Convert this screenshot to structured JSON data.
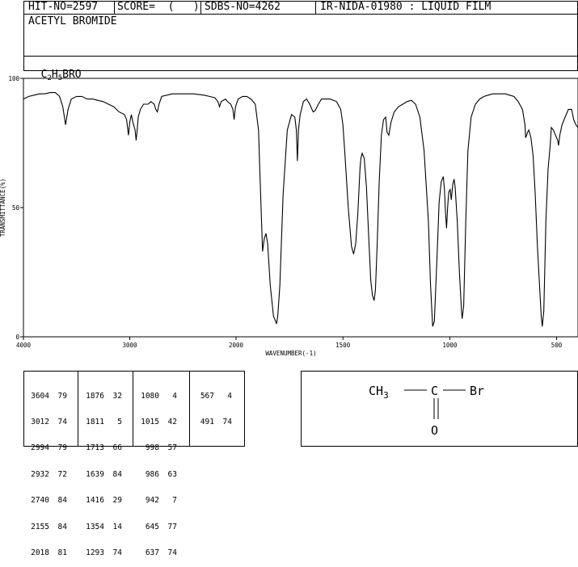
{
  "header": {
    "hit_no": "HIT-NO=2597",
    "score": "SCORE=  (   )",
    "sdbs_no": "SDBS-NO=4262",
    "ir_info": "IR-NIDA-01980 : LIQUID FILM",
    "compound_name": "ACETYL BROMIDE",
    "formula": {
      "c": "C",
      "c_sub": "2",
      "h": "H",
      "h_sub": "5",
      "rest": "BRO"
    }
  },
  "chart_data": {
    "type": "line",
    "xlabel": "WAVENUMBER(-1)",
    "ylabel": "TRANSMITTANCE(%)",
    "xlim": [
      4000,
      400
    ],
    "ylim": [
      0,
      100
    ],
    "x_ticks": [
      4000,
      3000,
      2000,
      1500,
      1000,
      500
    ],
    "y_ticks": [
      0,
      50,
      100
    ],
    "x_tick_labels": [
      "4000",
      "3000",
      "2000",
      "1500",
      "1000",
      "500"
    ],
    "y_tick_labels": [
      "0",
      "50",
      "100"
    ],
    "grid": false,
    "series_color": "#000000",
    "spectrum": [
      [
        4000,
        92
      ],
      [
        3950,
        93
      ],
      [
        3900,
        93.5
      ],
      [
        3850,
        94
      ],
      [
        3800,
        94
      ],
      [
        3750,
        94.5
      ],
      [
        3700,
        94.5
      ],
      [
        3660,
        93
      ],
      [
        3630,
        89
      ],
      [
        3604,
        82
      ],
      [
        3580,
        88
      ],
      [
        3550,
        92
      ],
      [
        3500,
        93
      ],
      [
        3450,
        93
      ],
      [
        3400,
        92
      ],
      [
        3350,
        92
      ],
      [
        3300,
        91.5
      ],
      [
        3250,
        91
      ],
      [
        3200,
        90
      ],
      [
        3150,
        89
      ],
      [
        3100,
        87
      ],
      [
        3050,
        86
      ],
      [
        3030,
        84
      ],
      [
        3012,
        78
      ],
      [
        3000,
        83
      ],
      [
        2985,
        86
      ],
      [
        2970,
        83
      ],
      [
        2950,
        80
      ],
      [
        2940,
        76
      ],
      [
        2932,
        79
      ],
      [
        2920,
        85
      ],
      [
        2900,
        88
      ],
      [
        2870,
        90
      ],
      [
        2830,
        90
      ],
      [
        2800,
        91
      ],
      [
        2770,
        90
      ],
      [
        2755,
        88
      ],
      [
        2740,
        87
      ],
      [
        2725,
        90
      ],
      [
        2700,
        93
      ],
      [
        2600,
        94
      ],
      [
        2500,
        94
      ],
      [
        2400,
        94
      ],
      [
        2300,
        93.5
      ],
      [
        2250,
        93
      ],
      [
        2200,
        92.5
      ],
      [
        2170,
        91
      ],
      [
        2155,
        89
      ],
      [
        2140,
        91
      ],
      [
        2100,
        92
      ],
      [
        2080,
        91
      ],
      [
        2050,
        90
      ],
      [
        2030,
        88
      ],
      [
        2018,
        84
      ],
      [
        2005,
        89
      ],
      [
        1990,
        92
      ],
      [
        1970,
        93
      ],
      [
        1950,
        93
      ],
      [
        1930,
        92
      ],
      [
        1910,
        90
      ],
      [
        1895,
        80
      ],
      [
        1885,
        55
      ],
      [
        1876,
        33
      ],
      [
        1868,
        38
      ],
      [
        1860,
        40
      ],
      [
        1852,
        36
      ],
      [
        1840,
        20
      ],
      [
        1825,
        8
      ],
      [
        1815,
        6
      ],
      [
        1811,
        5
      ],
      [
        1805,
        8
      ],
      [
        1795,
        20
      ],
      [
        1780,
        55
      ],
      [
        1760,
        80
      ],
      [
        1740,
        86
      ],
      [
        1725,
        85
      ],
      [
        1718,
        80
      ],
      [
        1713,
        68
      ],
      [
        1708,
        80
      ],
      [
        1700,
        86
      ],
      [
        1685,
        91
      ],
      [
        1670,
        92
      ],
      [
        1655,
        90
      ],
      [
        1645,
        88
      ],
      [
        1639,
        87
      ],
      [
        1630,
        87.5
      ],
      [
        1615,
        90
      ],
      [
        1600,
        92
      ],
      [
        1560,
        92
      ],
      [
        1530,
        91
      ],
      [
        1510,
        88
      ],
      [
        1500,
        82
      ],
      [
        1490,
        70
      ],
      [
        1475,
        50
      ],
      [
        1460,
        35
      ],
      [
        1450,
        32
      ],
      [
        1440,
        36
      ],
      [
        1430,
        48
      ],
      [
        1420,
        65
      ],
      [
        1416,
        69
      ],
      [
        1410,
        71
      ],
      [
        1400,
        69
      ],
      [
        1390,
        58
      ],
      [
        1380,
        40
      ],
      [
        1370,
        22
      ],
      [
        1362,
        16
      ],
      [
        1354,
        14
      ],
      [
        1348,
        18
      ],
      [
        1340,
        35
      ],
      [
        1330,
        60
      ],
      [
        1320,
        78
      ],
      [
        1310,
        84
      ],
      [
        1300,
        85
      ],
      [
        1293,
        79
      ],
      [
        1285,
        78
      ],
      [
        1275,
        83
      ],
      [
        1260,
        87
      ],
      [
        1240,
        89
      ],
      [
        1220,
        90
      ],
      [
        1200,
        91
      ],
      [
        1180,
        91.5
      ],
      [
        1160,
        90
      ],
      [
        1140,
        85
      ],
      [
        1120,
        72
      ],
      [
        1100,
        45
      ],
      [
        1090,
        20
      ],
      [
        1080,
        4
      ],
      [
        1072,
        6
      ],
      [
        1060,
        30
      ],
      [
        1050,
        52
      ],
      [
        1040,
        60
      ],
      [
        1030,
        62
      ],
      [
        1025,
        57
      ],
      [
        1020,
        48
      ],
      [
        1015,
        42
      ],
      [
        1010,
        50
      ],
      [
        1005,
        56
      ],
      [
        998,
        57
      ],
      [
        993,
        53
      ],
      [
        988,
        57
      ],
      [
        986,
        59
      ],
      [
        980,
        61
      ],
      [
        975,
        58
      ],
      [
        965,
        45
      ],
      [
        955,
        25
      ],
      [
        945,
        10
      ],
      [
        942,
        7
      ],
      [
        935,
        12
      ],
      [
        925,
        45
      ],
      [
        915,
        72
      ],
      [
        900,
        85
      ],
      [
        880,
        90
      ],
      [
        860,
        92
      ],
      [
        840,
        93
      ],
      [
        820,
        93.5
      ],
      [
        800,
        94
      ],
      [
        780,
        94
      ],
      [
        760,
        94
      ],
      [
        740,
        94
      ],
      [
        720,
        93.5
      ],
      [
        700,
        93
      ],
      [
        680,
        91
      ],
      [
        660,
        88
      ],
      [
        648,
        82
      ],
      [
        645,
        77
      ],
      [
        640,
        78
      ],
      [
        637,
        79
      ],
      [
        630,
        80
      ],
      [
        620,
        77
      ],
      [
        610,
        70
      ],
      [
        600,
        55
      ],
      [
        590,
        35
      ],
      [
        580,
        20
      ],
      [
        572,
        8
      ],
      [
        567,
        4
      ],
      [
        560,
        10
      ],
      [
        550,
        45
      ],
      [
        540,
        65
      ],
      [
        530,
        74
      ],
      [
        525,
        81
      ],
      [
        515,
        80
      ],
      [
        505,
        78
      ],
      [
        495,
        76
      ],
      [
        491,
        74
      ],
      [
        485,
        78
      ],
      [
        475,
        82
      ],
      [
        460,
        85
      ],
      [
        445,
        88
      ],
      [
        430,
        88
      ],
      [
        420,
        84
      ],
      [
        410,
        82
      ],
      [
        400,
        81
      ]
    ]
  },
  "peak_table": {
    "columns": [
      [
        [
          "3604",
          "79"
        ],
        [
          "3012",
          "74"
        ],
        [
          "2994",
          "79"
        ],
        [
          "2932",
          "72"
        ],
        [
          "2740",
          "84"
        ],
        [
          "2155",
          "84"
        ],
        [
          "2018",
          "81"
        ]
      ],
      [
        [
          "1876",
          "32"
        ],
        [
          "1811",
          "5"
        ],
        [
          "1713",
          "66"
        ],
        [
          "1639",
          "84"
        ],
        [
          "1416",
          "29"
        ],
        [
          "1354",
          "14"
        ],
        [
          "1293",
          "74"
        ]
      ],
      [
        [
          "1080",
          "4"
        ],
        [
          "1015",
          "42"
        ],
        [
          "998",
          "57"
        ],
        [
          "986",
          "63"
        ],
        [
          "942",
          "7"
        ],
        [
          "645",
          "77"
        ],
        [
          "637",
          "74"
        ]
      ],
      [
        [
          "567",
          "4"
        ],
        [
          "491",
          "74"
        ]
      ]
    ]
  },
  "structure": {
    "ch3": "CH",
    "ch3_sub": "3",
    "carbon": "C",
    "bromine": "Br",
    "oxygen": "O"
  }
}
